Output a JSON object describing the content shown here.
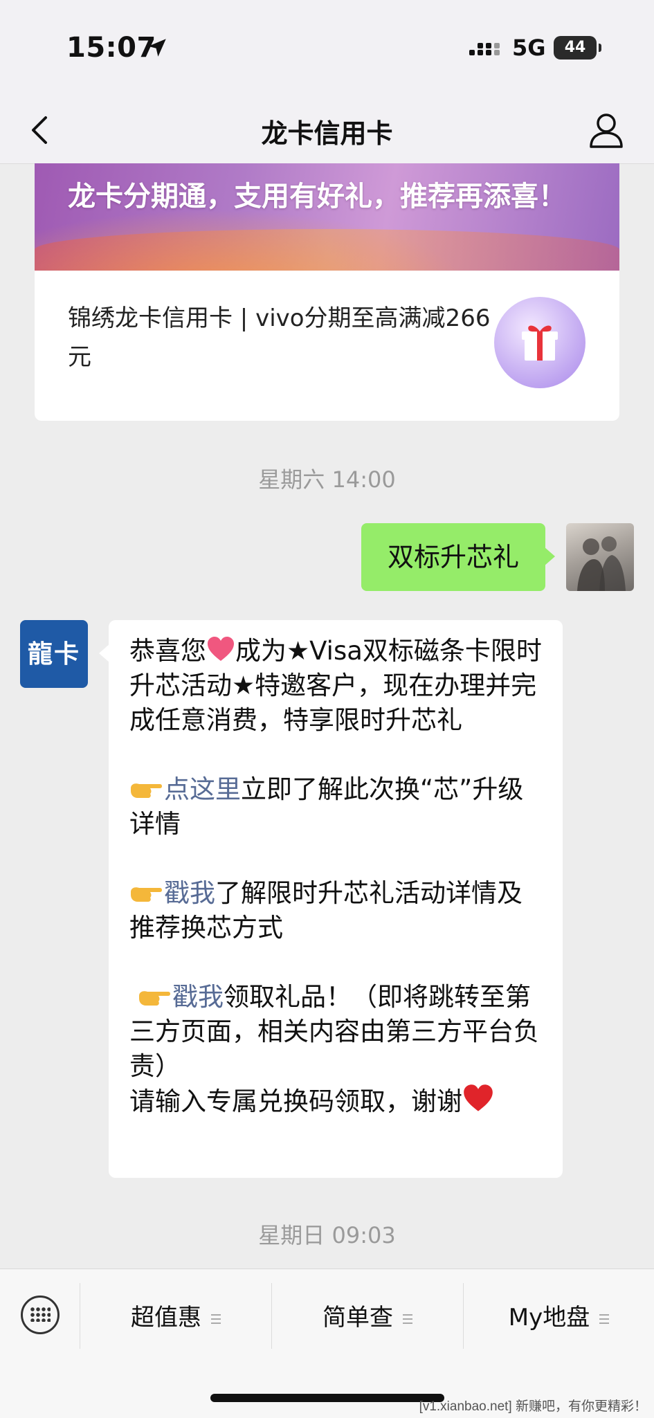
{
  "status_bar": {
    "time": "15:07",
    "network": "5G",
    "battery": "44"
  },
  "nav": {
    "title": "龙卡信用卡"
  },
  "promo_card": {
    "banner_text": "龙卡分期通，支用有好礼，推荐再添喜！",
    "description": "锦绣龙卡信用卡 | vivo分期至高满减266元"
  },
  "messages": {
    "time_1": "星期六 14:00",
    "sent_text": "双标升芯礼",
    "bank_avatar_text": "龍卡",
    "recv": {
      "p1_a": "恭喜您",
      "p1_b": "成为★Visa双标磁条卡限时升芯活动★特邀客户，现在办理并完成任意消费，特享限时升芯礼",
      "p2_link": "点这里",
      "p2_text": "立即了解此次换“芯”升级详情",
      "p3_link": "戳我",
      "p3_text": "了解限时升芯礼活动详情及推荐换芯方式",
      "p4_link": "戳我",
      "p4_text": "领取礼品！（即将跳转至第三方页面，相关内容由第三方平台负责）",
      "p5_text": "请输入专属兑换码领取，谢谢"
    },
    "time_2": "星期日 09:03"
  },
  "bottom_menu": {
    "items": [
      {
        "label": "超值惠"
      },
      {
        "label": "简单查"
      },
      {
        "label": "My地盘"
      }
    ]
  },
  "watermark": "[v1.xianbao.net] 新赚吧，有你更精彩！"
}
